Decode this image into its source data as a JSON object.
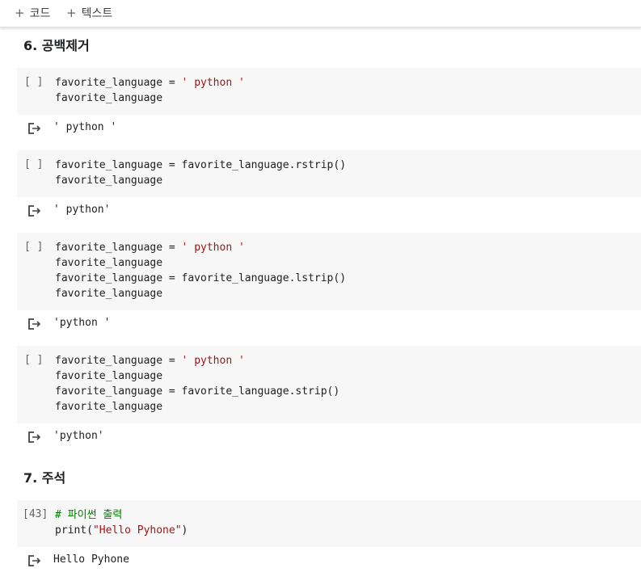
{
  "toolbar": {
    "add_code_label": "코드",
    "add_text_label": "텍스트"
  },
  "sections": [
    {
      "heading": "6. 공백제거",
      "cells": [
        {
          "indicator": "[ ]",
          "lines": [
            [
              {
                "t": "favorite_language = ",
                "c": "plain"
              },
              {
                "t": "' python '",
                "c": "str"
              }
            ],
            [
              {
                "t": "favorite_language",
                "c": "plain"
              }
            ]
          ],
          "output": "' python '"
        },
        {
          "indicator": "[ ]",
          "lines": [
            [
              {
                "t": "favorite_language = favorite_language.rstrip()",
                "c": "plain"
              }
            ],
            [
              {
                "t": "favorite_language",
                "c": "plain"
              }
            ]
          ],
          "output": "' python'"
        },
        {
          "indicator": "[ ]",
          "lines": [
            [
              {
                "t": "favorite_language = ",
                "c": "plain"
              },
              {
                "t": "' python '",
                "c": "str"
              }
            ],
            [
              {
                "t": "favorite_language",
                "c": "plain"
              }
            ],
            [
              {
                "t": "favorite_language = favorite_language.lstrip()",
                "c": "plain"
              }
            ],
            [
              {
                "t": "favorite_language",
                "c": "plain"
              }
            ]
          ],
          "output": "'python '"
        },
        {
          "indicator": "[ ]",
          "lines": [
            [
              {
                "t": "favorite_language = ",
                "c": "plain"
              },
              {
                "t": "' python '",
                "c": "str"
              }
            ],
            [
              {
                "t": "favorite_language",
                "c": "plain"
              }
            ],
            [
              {
                "t": "favorite_language = favorite_language.strip()",
                "c": "plain"
              }
            ],
            [
              {
                "t": "favorite_language",
                "c": "plain"
              }
            ]
          ],
          "output": "'python'"
        }
      ]
    },
    {
      "heading": "7. 주석",
      "cells": [
        {
          "indicator": "[43]",
          "lines": [
            [
              {
                "t": "# 파이썬 출력",
                "c": "cmt"
              }
            ],
            [
              {
                "t": "print(",
                "c": "plain"
              },
              {
                "t": "\"Hello Pyhone\"",
                "c": "str"
              },
              {
                "t": ")",
                "c": "plain"
              }
            ]
          ],
          "output": "Hello Pyhone"
        }
      ]
    }
  ]
}
